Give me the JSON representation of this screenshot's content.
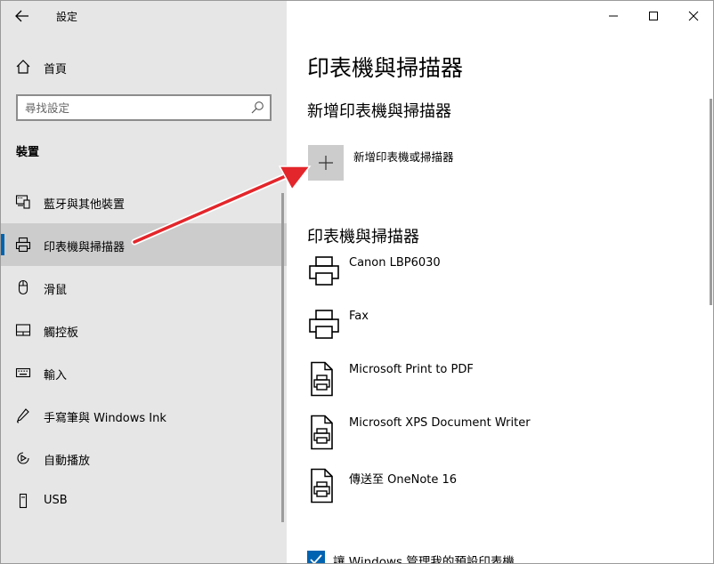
{
  "window": {
    "title": "設定",
    "controls": {
      "minimize": "minimize",
      "maximize": "maximize",
      "close": "close"
    }
  },
  "sidebar": {
    "home_label": "首頁",
    "search_placeholder": "尋找設定",
    "section_title": "裝置",
    "items": [
      {
        "label": "藍牙與其他裝置",
        "icon": "bluetooth-devices-icon",
        "selected": false
      },
      {
        "label": "印表機與掃描器",
        "icon": "printer-icon",
        "selected": true
      },
      {
        "label": "滑鼠",
        "icon": "mouse-icon",
        "selected": false
      },
      {
        "label": "觸控板",
        "icon": "touchpad-icon",
        "selected": false
      },
      {
        "label": "輸入",
        "icon": "keyboard-icon",
        "selected": false
      },
      {
        "label": "手寫筆與 Windows Ink",
        "icon": "pen-icon",
        "selected": false
      },
      {
        "label": "自動播放",
        "icon": "autoplay-icon",
        "selected": false
      },
      {
        "label": "USB",
        "icon": "usb-icon",
        "selected": false
      }
    ]
  },
  "main": {
    "title": "印表機與掃描器",
    "add_heading": "新增印表機與掃描器",
    "add_button_label": "新增印表機或掃描器",
    "list_heading": "印表機與掃描器",
    "devices": [
      {
        "name": "Canon LBP6030",
        "icon": "printer-icon"
      },
      {
        "name": "Fax",
        "icon": "printer-icon"
      },
      {
        "name": "Microsoft Print to PDF",
        "icon": "document-printer-icon"
      },
      {
        "name": "Microsoft XPS Document Writer",
        "icon": "document-printer-icon"
      },
      {
        "name": "傳送至 OneNote 16",
        "icon": "document-printer-icon"
      }
    ],
    "checkbox_label": "讓 Windows 管理我的預設印表機",
    "checkbox_checked": true
  },
  "colors": {
    "accent": "#0063b1",
    "sidebar_bg": "#e6e6e6",
    "selected_bg": "#cccccc",
    "arrow": "#e3262b"
  }
}
